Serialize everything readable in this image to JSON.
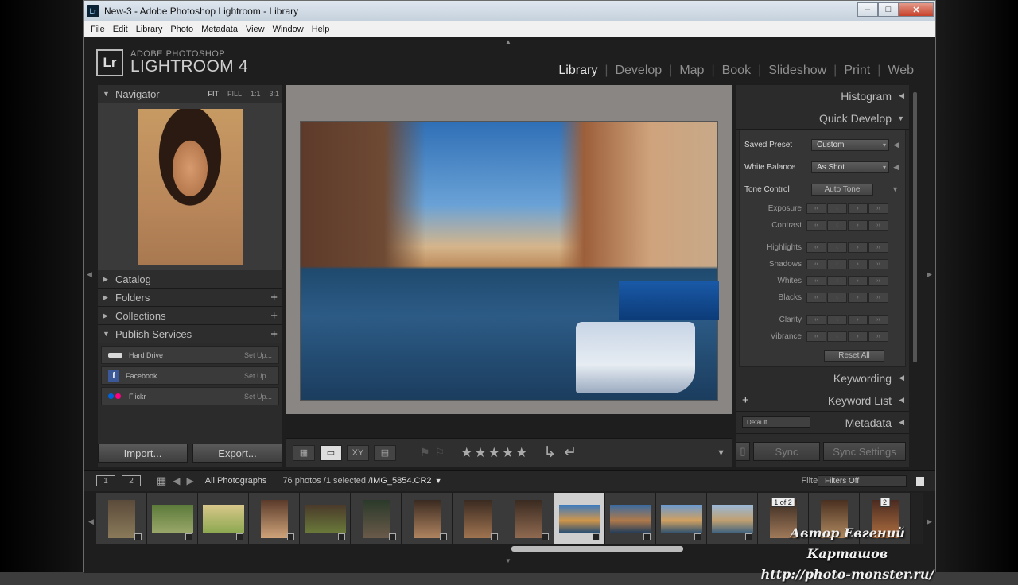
{
  "window": {
    "title": "New-3 - Adobe Photoshop Lightroom - Library",
    "app_icon": "Lr"
  },
  "menu": [
    "File",
    "Edit",
    "Library",
    "Photo",
    "Metadata",
    "View",
    "Window",
    "Help"
  ],
  "identity": {
    "logo": "Lr",
    "line1": "ADOBE PHOTOSHOP",
    "line2": "LIGHTROOM 4"
  },
  "modules": [
    "Library",
    "Develop",
    "Map",
    "Book",
    "Slideshow",
    "Print",
    "Web"
  ],
  "active_module": "Library",
  "left_panel": {
    "navigator": {
      "label": "Navigator",
      "options": [
        "FIT",
        "FILL",
        "1:1",
        "3:1"
      ]
    },
    "sections": [
      {
        "label": "Catalog",
        "expanded": false
      },
      {
        "label": "Folders",
        "expanded": false
      },
      {
        "label": "Collections",
        "expanded": false
      },
      {
        "label": "Publish Services",
        "expanded": true
      }
    ],
    "publish_services": [
      {
        "name": "Hard Drive",
        "action": "Set Up..."
      },
      {
        "name": "Facebook",
        "action": "Set Up..."
      },
      {
        "name": "Flickr",
        "action": "Set Up..."
      }
    ],
    "import_label": "Import...",
    "export_label": "Export..."
  },
  "toolbar": {
    "grid": "grid-view-icon",
    "loupe": "loupe-view-icon",
    "compare": "XY",
    "survey": "survey-view-icon",
    "stars": "★★★★★"
  },
  "right_panel": {
    "histogram": "Histogram",
    "quick_develop": "Quick Develop",
    "saved_preset": {
      "label": "Saved Preset",
      "value": "Custom"
    },
    "white_balance": {
      "label": "White Balance",
      "value": "As Shot"
    },
    "tone_control": {
      "label": "Tone Control",
      "button": "Auto Tone"
    },
    "sliders_a": [
      "Exposure",
      "Contrast"
    ],
    "sliders_b": [
      "Highlights",
      "Shadows",
      "Whites",
      "Blacks"
    ],
    "sliders_c": [
      "Clarity",
      "Vibrance"
    ],
    "reset": "Reset All",
    "keywording": "Keywording",
    "keyword_list": "Keyword List",
    "metadata": "Metadata",
    "metadata_preset": "Default",
    "sync": "Sync",
    "sync_settings": "Sync Settings"
  },
  "filmstrip_bar": {
    "screen1": "1",
    "screen2": "2",
    "source": "All Photographs",
    "count": "76 photos /1 selected /",
    "filename": "IMG_5854.CR2",
    "filter_label": "Filter :",
    "filter_value": "Filters Off"
  },
  "filmstrip": {
    "stack_badge_1": "1 of 2",
    "stack_badge_2": "2"
  },
  "watermark": {
    "line1": "Автор Евгений Карташов",
    "line2": "http://photo-monster.ru/"
  },
  "colors": {
    "panel": "#2b2b2b",
    "background": "#1e1e1e",
    "center": "#898683",
    "active_text": "#e6e6e6"
  }
}
